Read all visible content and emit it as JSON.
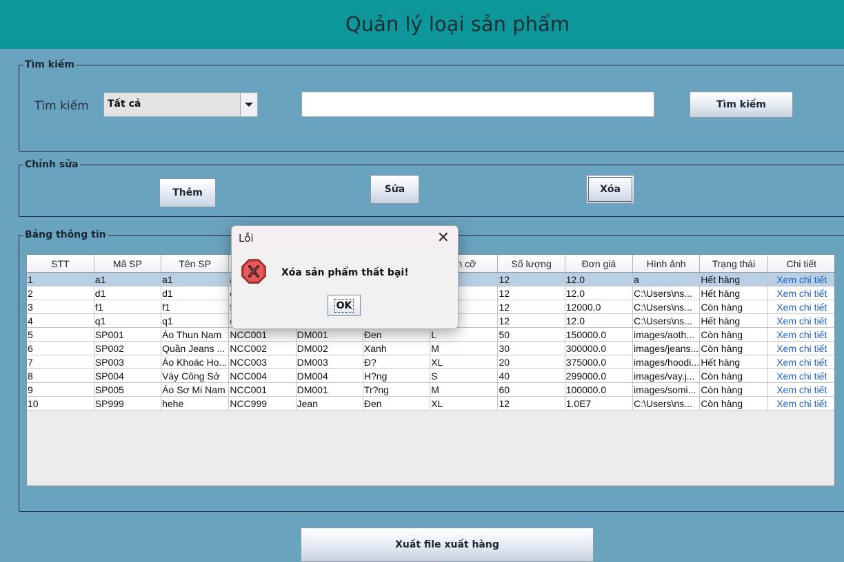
{
  "header": {
    "title": "Quản lý loại sản phẩm"
  },
  "search": {
    "legend": "Tìm kiếm",
    "label": "Tìm kiếm",
    "combo_value": "Tất cả",
    "input_value": "",
    "button": "Tìm kiếm"
  },
  "edit": {
    "legend": "Chỉnh sửa",
    "add": "Thêm",
    "update": "Sửa",
    "delete": "Xóa"
  },
  "table": {
    "legend": "Bảng thông tin",
    "columns": [
      "STT",
      "Mã SP",
      "Tên SP",
      "",
      "",
      "",
      "ch cỡ",
      "Số lượng",
      "Đơn giá",
      "Hình ảnh",
      "Trạng thái",
      "Chi tiết"
    ],
    "rows": [
      [
        "1",
        "a1",
        "a1",
        "a",
        "",
        "",
        "",
        "12",
        "12.0",
        "a",
        "Hết hàng",
        "Xem chi tiết"
      ],
      [
        "2",
        "d1",
        "d1",
        "d",
        "",
        "",
        "",
        "12",
        "12.0",
        "C:\\Users\\ns...",
        "Hết hàng",
        "Xem chi tiết"
      ],
      [
        "3",
        "f1",
        "f1",
        "f",
        "",
        "",
        "",
        "12",
        "12000.0",
        "C:\\Users\\ns...",
        "Còn hàng",
        "Xem chi tiết"
      ],
      [
        "4",
        "q1",
        "q1",
        "q",
        "",
        "",
        "",
        "12",
        "12.0",
        "C:\\Users\\ns...",
        "Hết hàng",
        "Xem chi tiết"
      ],
      [
        "5",
        "SP001",
        "Áo Thun Nam",
        "NCC001",
        "DM001",
        "Đen",
        "L",
        "50",
        "150000.0",
        "images/aoth...",
        "Còn hàng",
        "Xem chi tiết"
      ],
      [
        "6",
        "SP002",
        "Quần Jeans ...",
        "NCC002",
        "DM002",
        "Xanh",
        "M",
        "30",
        "300000.0",
        "images/jeans...",
        "Còn hàng",
        "Xem chi tiết"
      ],
      [
        "7",
        "SP003",
        "Áo Khoác Ho...",
        "NCC003",
        "DM003",
        "Đ?",
        "XL",
        "20",
        "375000.0",
        "images/hoodi...",
        "Hết hàng",
        "Xem chi tiết"
      ],
      [
        "8",
        "SP004",
        "Váy Công Sở",
        "NCC004",
        "DM004",
        "H?ng",
        "S",
        "40",
        "299000.0",
        "images/vay.j...",
        "Còn hàng",
        "Xem chi tiết"
      ],
      [
        "9",
        "SP005",
        "Áo Sơ Mi Nam",
        "NCC001",
        "DM001",
        "Tr?ng",
        "M",
        "60",
        "100000.0",
        "images/somi...",
        "Còn hàng",
        "Xem chi tiết"
      ],
      [
        "10",
        "SP999",
        "hehe",
        "NCC999",
        "Jean",
        "Đen",
        "XL",
        "12",
        "1.0E7",
        "C:\\Users\\ns...",
        "Còn hàng",
        "Xem chi tiết"
      ]
    ]
  },
  "export_button": "Xuất file xuất hàng",
  "dialog": {
    "title": "Lỗi",
    "message": "Xóa sản phẩm thất bại!",
    "ok": "OK",
    "icon": "error-icon"
  }
}
